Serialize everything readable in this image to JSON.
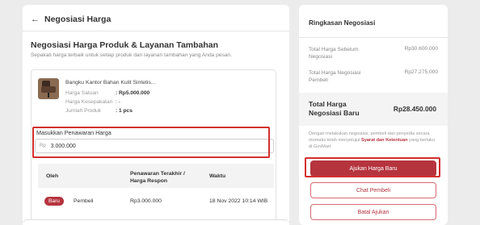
{
  "header": {
    "back_title": "Negosiasi Harga"
  },
  "main": {
    "title": "Negosiasi Harga Produk & Layanan Tambahan",
    "subtitle": "Sepakati harga terbaik untuk setiap produk dan layanan tambahan yang Anda pesan."
  },
  "product": {
    "name": "Bangku Kantor Bahan Kulit Sintetis...",
    "rows": [
      {
        "label": "Harga Satuan",
        "value": ": Rp5.000.000"
      },
      {
        "label": "Harga Kesepakatan",
        "value": ": -"
      },
      {
        "label": "Jumlah Produk",
        "value": ": 1 pcs"
      }
    ],
    "thumbnail_icon": "office-chair-image"
  },
  "offer": {
    "label": "Masukkan Penawaran Harga",
    "prefix": "Rp",
    "value": "3.000.000"
  },
  "history_table": {
    "headers": {
      "by": "Oleh",
      "offer": "Penawaran Terakhir / Harga Respon",
      "time": "Waktu"
    },
    "rows": [
      {
        "badge": "Baru",
        "role": "Pembeli",
        "price": "Rp3.000.000",
        "time": "18 Nov 2022 10:14 WIB"
      }
    ]
  },
  "summary": {
    "title": "Ringkasan Negosiasi",
    "before_label": "Total Harga Sebelum Negosiasi",
    "before_value": "Rp30.600.000",
    "buyer_label": "Total Harga Negosiasi Pembeli",
    "buyer_value": "Rp27.275.000",
    "new_label": "Total Harga Negosiasi Baru",
    "new_value": "Rp28.450.000",
    "note_prefix": "Dengan melakukan negosiasi, pembeli dan penyedia secara otomatis telah menyetujui ",
    "note_link": "Syarat dan Ketentuan",
    "note_suffix": " yang berlaku di GovMart."
  },
  "buttons": {
    "submit": "Ajukan Harga Baru",
    "chat": "Chat Pembeli",
    "cancel": "Batal Ajukan"
  },
  "colors": {
    "accent": "#b5343e",
    "highlight": "#d32f2f"
  }
}
